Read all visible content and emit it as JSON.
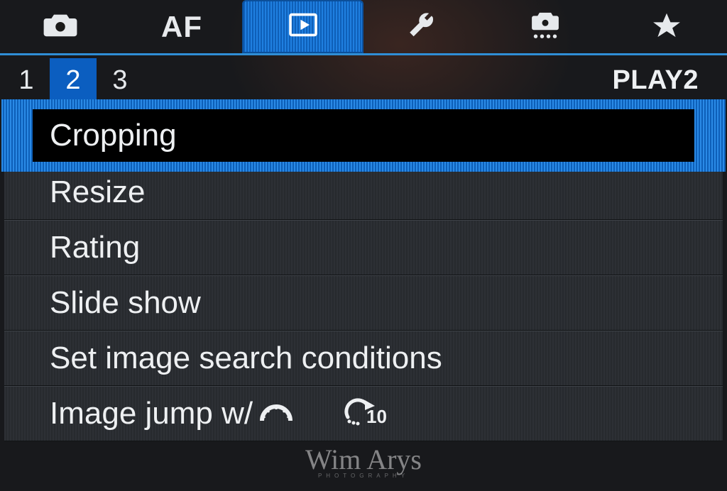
{
  "top_tabs": {
    "items": [
      {
        "name": "shooting-tab",
        "icon": "camera-icon",
        "active": false
      },
      {
        "name": "af-tab",
        "label": "AF",
        "active": false
      },
      {
        "name": "playback-tab",
        "icon": "play-icon",
        "active": true
      },
      {
        "name": "setup-tab",
        "icon": "wrench-icon",
        "active": false
      },
      {
        "name": "custom-fn-tab",
        "icon": "camera-dots-icon",
        "active": false
      },
      {
        "name": "my-menu-tab",
        "icon": "star-icon",
        "active": false
      }
    ]
  },
  "sub_tabs": {
    "pages": [
      "1",
      "2",
      "3"
    ],
    "active_index": 1,
    "section_label": "PLAY2"
  },
  "menu": {
    "items": [
      {
        "label": "Cropping",
        "selected": true
      },
      {
        "label": "Resize",
        "selected": false
      },
      {
        "label": "Rating",
        "selected": false
      },
      {
        "label": "Slide show",
        "selected": false
      },
      {
        "label": "Set image search conditions",
        "selected": false
      },
      {
        "label": "Image jump w/",
        "selected": false,
        "label_icon": "main-dial-icon",
        "value_icon": "jump10-icon"
      }
    ]
  },
  "watermark": {
    "name": "Wim Arys",
    "sub": "PHOTOGRAPHY"
  }
}
